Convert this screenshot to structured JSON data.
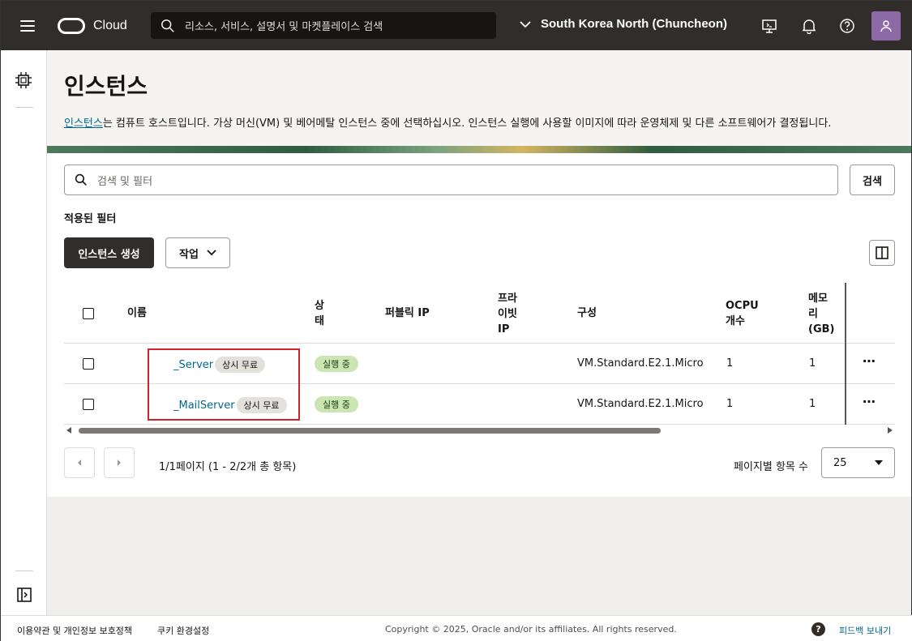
{
  "header": {
    "brand": "Cloud",
    "search_placeholder": "리소스, 서비스, 설명서 및 마켓플레이스 검색",
    "region": "South Korea North (Chuncheon)"
  },
  "page": {
    "title": "인스턴스",
    "desc_link": "인스턴스",
    "desc_text": "는 컴퓨트 호스트입니다. 가상 머신(VM) 및 베어메탈 인스턴스 중에 선택하십시오. 인스턴스 실행에 사용할 이미지에 따라 운영체제 및 다른 소프트웨어가 결정됩니다."
  },
  "filter": {
    "placeholder": "검색 및 필터",
    "search_button": "검색",
    "applied_label": "적용된 필터"
  },
  "actions": {
    "create": "인스턴스 생성",
    "actions_menu": "작업"
  },
  "table": {
    "headers": {
      "name": "이름",
      "status": "상\n태",
      "public_ip": "퍼블릭 IP",
      "private_ip": "프라\n이빗\nIP",
      "shape": "구성",
      "ocpu": "OCPU\n개수",
      "memory": "메모\n리\n(GB)"
    },
    "rows": [
      {
        "name": "_Server",
        "badge": "상시 무료",
        "status": "실행 중",
        "public_ip": "",
        "private_ip": "",
        "shape": "VM.Standard.E2.1.Micro",
        "ocpu": "1",
        "memory": "1"
      },
      {
        "name": "_MailServer",
        "badge": "상시 무료",
        "status": "실행 중",
        "public_ip": "",
        "private_ip": "",
        "shape": "VM.Standard.E2.1.Micro",
        "ocpu": "1",
        "memory": "1"
      }
    ]
  },
  "pagination": {
    "summary": "1/1페이지 (1 - 2/2개 총 항목)",
    "per_page_label": "페이지별 항목 수",
    "per_page_value": "25"
  },
  "footer": {
    "terms": "이용약관 및 개인정보 보호정책",
    "cookies": "쿠키 환경설정",
    "copyright": "Copyright © 2025, Oracle and/or its affiliates. All rights reserved.",
    "feedback": "피드백 보내기"
  },
  "colors": {
    "header_bg": "#312d2a",
    "link": "#00688c",
    "status_bg": "#cce6b3",
    "highlight_box": "#d0232b"
  }
}
